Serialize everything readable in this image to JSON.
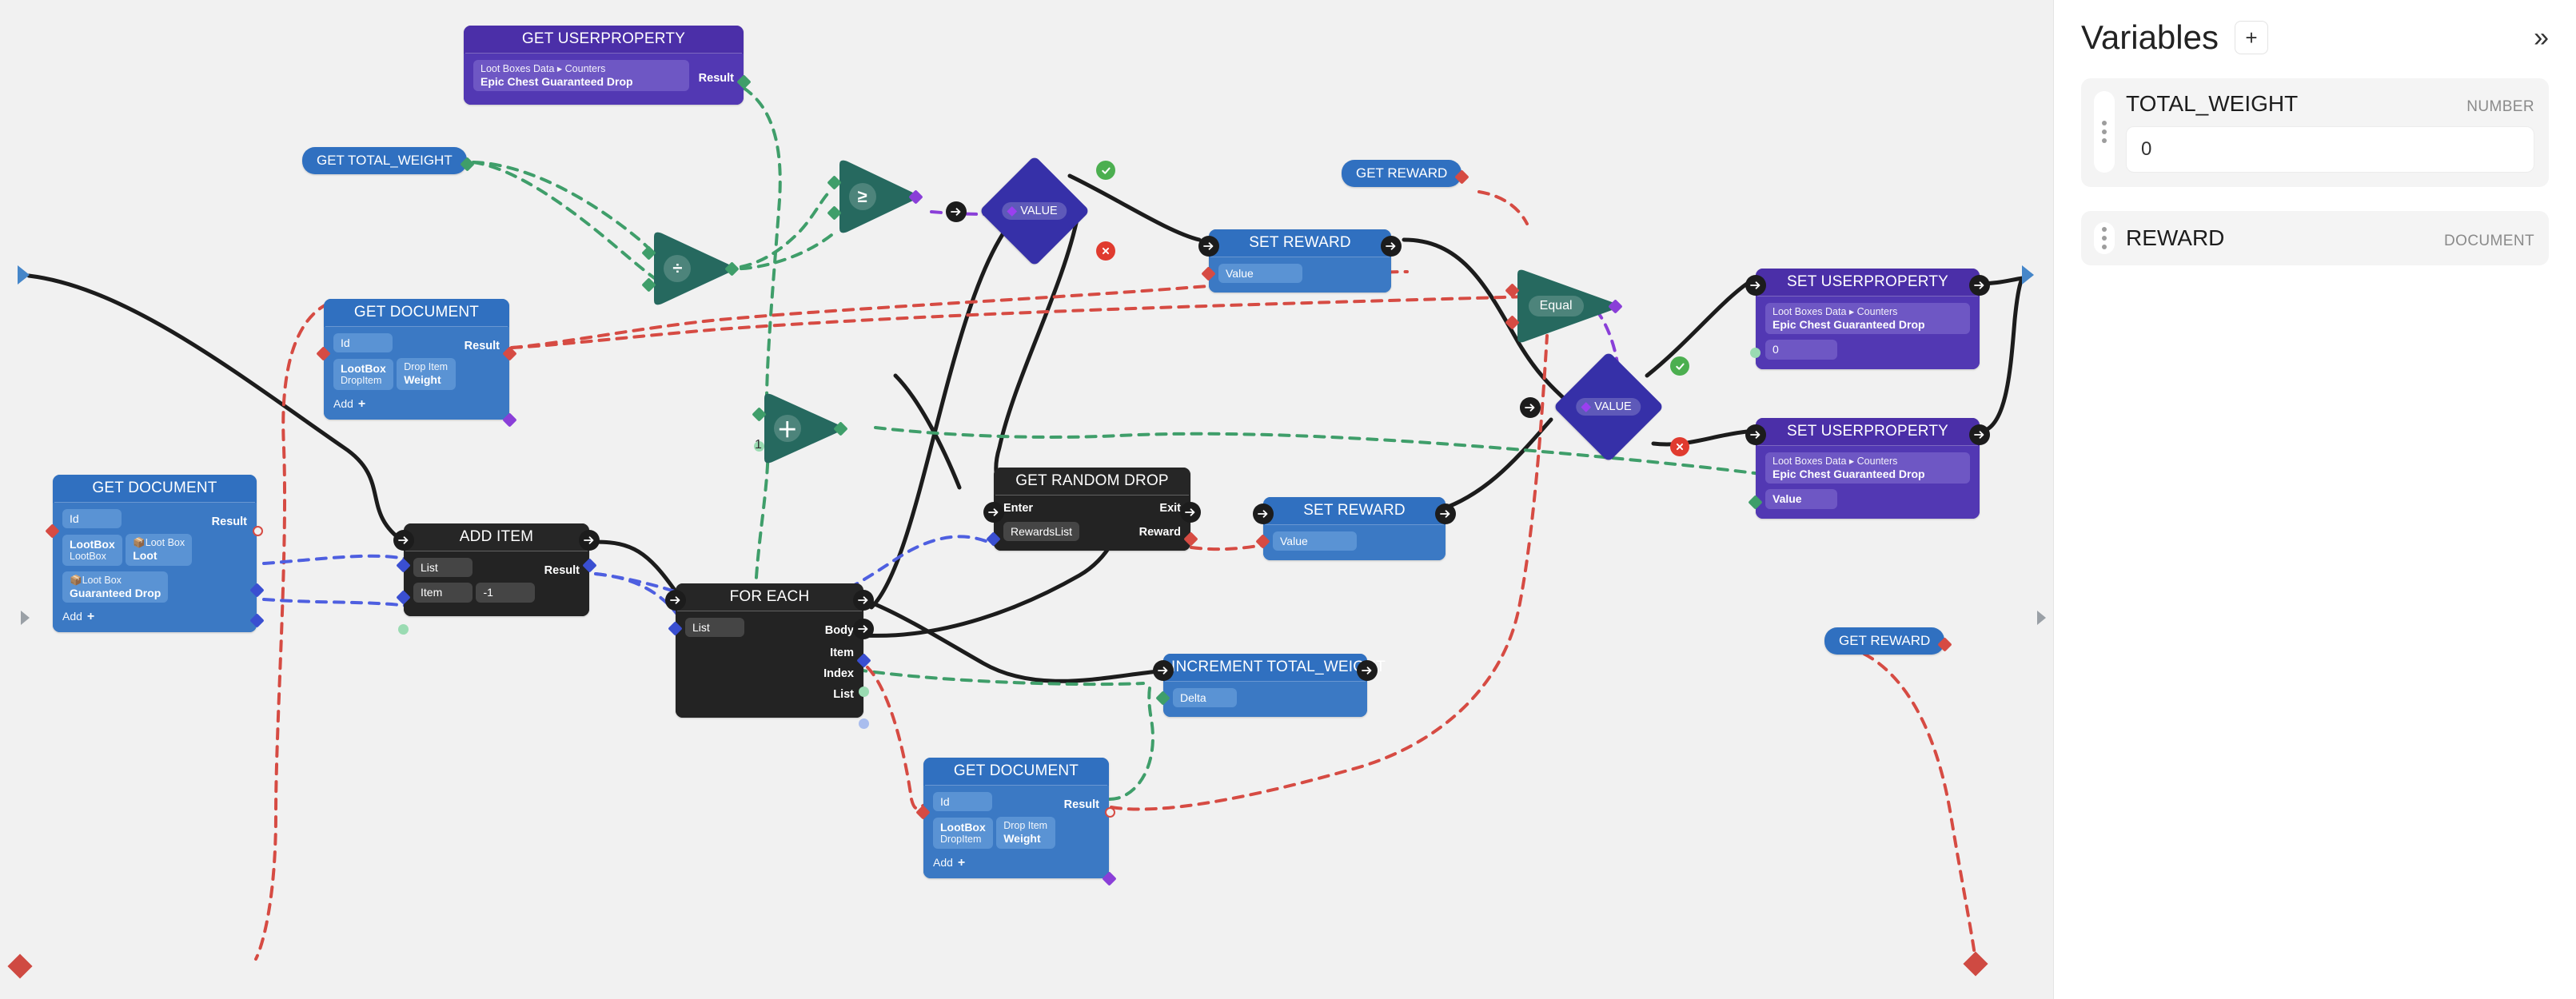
{
  "panel": {
    "title": "Variables",
    "add_label": "+",
    "collapse_icon": "»",
    "variables": [
      {
        "name": "TOTAL_WEIGHT",
        "type": "NUMBER",
        "value": "0",
        "has_input": true
      },
      {
        "name": "REWARD",
        "type": "DOCUMENT",
        "value": "",
        "has_input": false
      }
    ]
  },
  "nodes": {
    "get_userproperty": {
      "title": "GET USERPROPERTY",
      "field_path": "Loot Boxes Data ▸ Counters",
      "field_name": "Epic Chest Guaranteed Drop",
      "output": "Result"
    },
    "get_total_weight": {
      "label": "GET TOTAL_WEIGHT"
    },
    "get_reward_top": {
      "label": "GET REWARD"
    },
    "get_reward_bottom": {
      "label": "GET REWARD"
    },
    "get_document_upper": {
      "title": "GET DOCUMENT",
      "id_label": "Id",
      "output": "Result",
      "rows": [
        {
          "sub": "LootBox",
          "main": "DropItem",
          "sub_first": true
        },
        {
          "sub": "Drop Item",
          "main": "Weight",
          "sub_first": true
        }
      ],
      "add_label": "Add"
    },
    "get_document_left": {
      "title": "GET DOCUMENT",
      "id_label": "Id",
      "output": "Result",
      "rows": [
        {
          "sub": "LootBox",
          "main": "LootBox",
          "sub_first": true
        },
        {
          "sub": "📦Loot Box",
          "main": "Loot",
          "sub_first": true
        },
        {
          "sub": "📦Loot Box",
          "main": "Guaranteed Drop",
          "sub_first": true
        }
      ],
      "add_label": "Add"
    },
    "get_document_bottom": {
      "title": "GET DOCUMENT",
      "id_label": "Id",
      "output": "Result",
      "rows": [
        {
          "sub": "LootBox",
          "main": "DropItem",
          "sub_first": true
        },
        {
          "sub": "Drop Item",
          "main": "Weight",
          "sub_first": true
        }
      ],
      "add_label": "Add"
    },
    "add_item": {
      "title": "ADD ITEM",
      "inputs": [
        "List",
        "Item",
        "-1"
      ],
      "output": "Result"
    },
    "for_each": {
      "title": "FOR EACH",
      "input": "List",
      "outputs": [
        "Body",
        "Item",
        "Index",
        "List"
      ]
    },
    "get_random_drop": {
      "title": "GET RANDOM DROP",
      "enter": "Enter",
      "exit": "Exit",
      "input": "RewardsList",
      "output": "Reward"
    },
    "set_reward_top": {
      "title": "SET REWARD",
      "input": "Value"
    },
    "set_reward_mid": {
      "title": "SET REWARD",
      "input": "Value"
    },
    "increment_total_weight": {
      "title": "INCREMENT TOTAL_WEIGHT",
      "input": "Delta"
    },
    "set_userproperty_top": {
      "title": "SET USERPROPERTY",
      "field_path": "Loot Boxes Data ▸ Counters",
      "field_name": "Epic Chest Guaranteed Drop",
      "value": "0"
    },
    "set_userproperty_bottom": {
      "title": "SET USERPROPERTY",
      "field_path": "Loot Boxes Data ▸ Counters",
      "field_name": "Epic Chest Guaranteed Drop",
      "value": "Value"
    },
    "op_divide": {
      "glyph": "÷",
      "name": "divide"
    },
    "op_gte": {
      "glyph": "≥",
      "name": "greater-or-equal"
    },
    "op_plus": {
      "glyph": "＋",
      "name": "add",
      "constant": "1"
    },
    "op_equal": {
      "label": "Equal",
      "name": "equal"
    },
    "branch_value_left": {
      "label": "VALUE"
    },
    "branch_value_right": {
      "label": "VALUE"
    }
  },
  "colors": {
    "canvas_bg": "#f1f1f1",
    "node_blue": "#3070c0",
    "node_purple": "#4b2fa8",
    "node_dark": "#262626",
    "op_green": "#26695f",
    "branch_indigo": "#3630a8",
    "edge_exec": "#1c1c1c",
    "edge_data_red": "#d64b43",
    "edge_data_green": "#3f9e6a",
    "edge_data_blue": "#4e5fe0",
    "edge_data_purple": "#8a3fd8",
    "badge_ok": "#4caf50",
    "badge_no": "#e03b2f"
  }
}
